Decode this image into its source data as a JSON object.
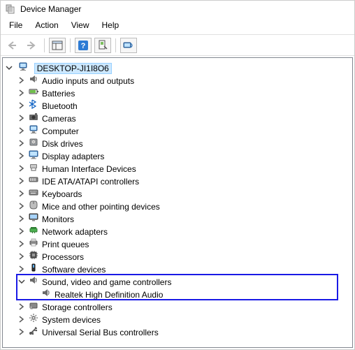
{
  "window": {
    "title": "Device Manager"
  },
  "menu": {
    "file": "File",
    "action": "Action",
    "view": "View",
    "help": "Help"
  },
  "root": {
    "name": "DESKTOP-JI1I8O6"
  },
  "categories": [
    {
      "id": "audio-io",
      "label": "Audio inputs and outputs"
    },
    {
      "id": "batteries",
      "label": "Batteries"
    },
    {
      "id": "bluetooth",
      "label": "Bluetooth"
    },
    {
      "id": "cameras",
      "label": "Cameras"
    },
    {
      "id": "computer",
      "label": "Computer"
    },
    {
      "id": "disk-drives",
      "label": "Disk drives"
    },
    {
      "id": "display-adapters",
      "label": "Display adapters"
    },
    {
      "id": "hid",
      "label": "Human Interface Devices"
    },
    {
      "id": "ide",
      "label": "IDE ATA/ATAPI controllers"
    },
    {
      "id": "keyboards",
      "label": "Keyboards"
    },
    {
      "id": "mice",
      "label": "Mice and other pointing devices"
    },
    {
      "id": "monitors",
      "label": "Monitors"
    },
    {
      "id": "network",
      "label": "Network adapters"
    },
    {
      "id": "print-queues",
      "label": "Print queues"
    },
    {
      "id": "processors",
      "label": "Processors"
    },
    {
      "id": "software-devices",
      "label": "Software devices"
    },
    {
      "id": "svg",
      "label": "Sound, video and game controllers"
    },
    {
      "id": "storage",
      "label": "Storage controllers"
    },
    {
      "id": "system-devices",
      "label": "System devices"
    },
    {
      "id": "usb",
      "label": "Universal Serial Bus controllers"
    }
  ],
  "svg_child": {
    "label": "Realtek High Definition Audio"
  }
}
